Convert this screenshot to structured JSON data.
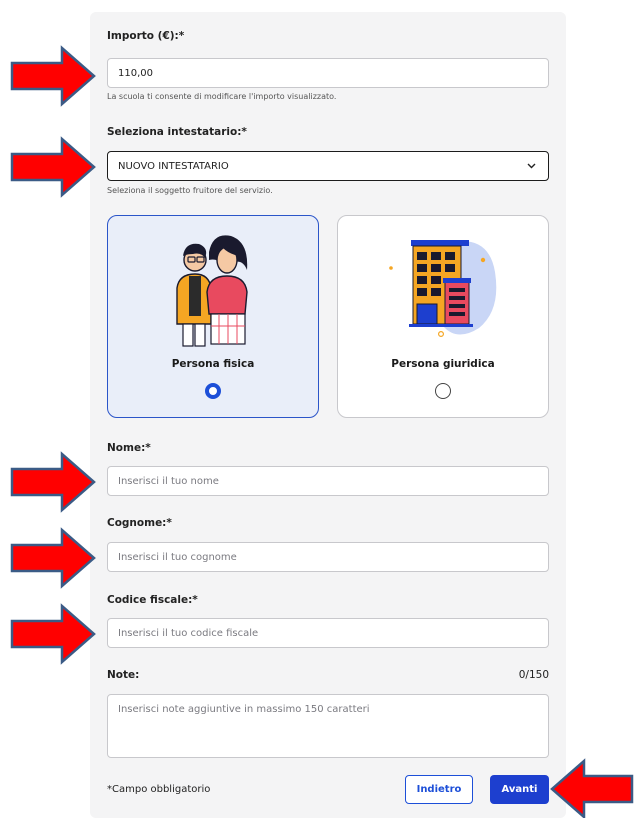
{
  "amount": {
    "label": "Importo (€):*",
    "value": "110,00",
    "hint": "La scuola ti consente di modificare l'importo visualizzato."
  },
  "holder": {
    "label": "Seleziona intestatario:*",
    "selected": "NUOVO INTESTATARIO",
    "hint": "Seleziona il soggetto fruitore del servizio."
  },
  "person_type": {
    "options": [
      {
        "label": "Persona fisica",
        "selected": true
      },
      {
        "label": "Persona giuridica",
        "selected": false
      }
    ]
  },
  "name": {
    "label": "Nome:*",
    "placeholder": "Inserisci il tuo nome"
  },
  "surname": {
    "label": "Cognome:*",
    "placeholder": "Inserisci il tuo cognome"
  },
  "tax_code": {
    "label": "Codice fiscale:*",
    "placeholder": "Inserisci il tuo codice fiscale"
  },
  "notes": {
    "label": "Note:",
    "counter": "0/150",
    "placeholder": "Inserisci note aggiuntive in massimo 150 caratteri"
  },
  "footer": {
    "required_note": "*Campo obbligatorio",
    "back_label": "Indietro",
    "next_label": "Avanti"
  },
  "colors": {
    "primary": "#1d3fcf",
    "selected_card_bg": "#e9eef9",
    "annotation_arrow_fill": "#ff0000",
    "annotation_arrow_stroke": "#3b5b86"
  },
  "icons": {
    "select_chevron": "chevron-down-icon",
    "person_illustration": "couple-illustration",
    "company_illustration": "building-illustration"
  }
}
